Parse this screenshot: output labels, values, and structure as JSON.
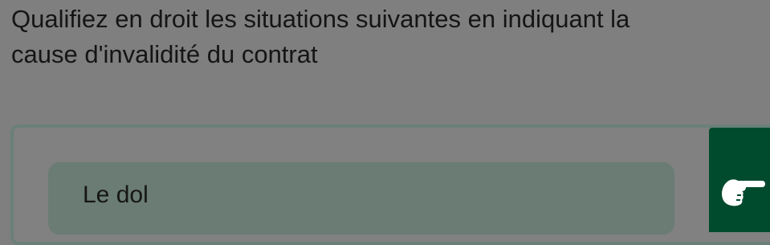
{
  "question": {
    "line1": "Qualifiez en droit les situations suivantes en indiquant  la",
    "line2": "cause d'invalidité du contrat"
  },
  "answer": {
    "option_label": "Le dol",
    "action_icon": "pointing-hand-icon"
  },
  "colors": {
    "overlay_bg": "#7f7f7f",
    "card_border": "#6a8079",
    "option_bg": "#6a7c74",
    "accent_button": "#004b2e"
  }
}
